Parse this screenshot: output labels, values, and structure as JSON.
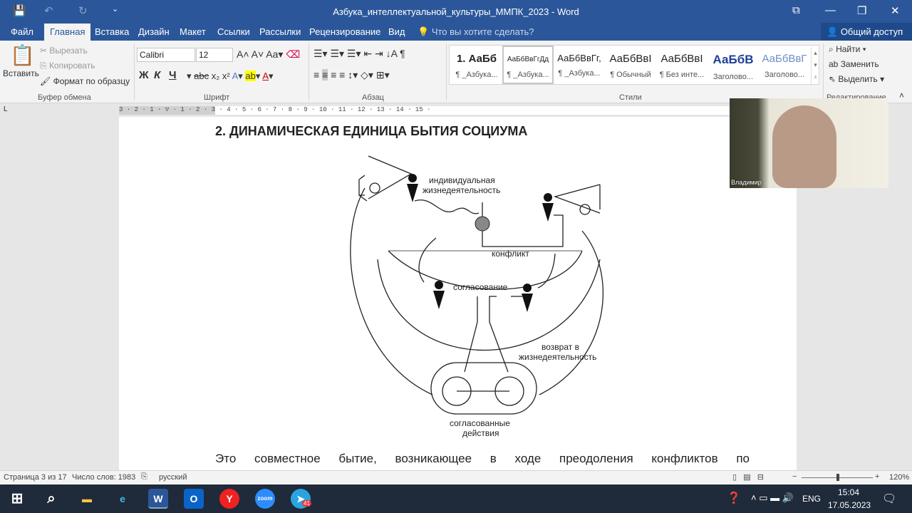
{
  "window": {
    "title": "Азбука_интеллектуальной_культуры_ММПК_2023 - Word"
  },
  "tabs": [
    "Файл",
    "Главная",
    "Вставка",
    "Дизайн",
    "Макет",
    "Ссылки",
    "Рассылки",
    "Рецензирование",
    "Вид"
  ],
  "tell_me": "Что вы хотите сделать?",
  "share": "Общий доступ",
  "clipboard": {
    "paste": "Вставить",
    "cut": "Вырезать",
    "copy": "Копировать",
    "format_painter": "Формат по образцу",
    "group": "Буфер обмена"
  },
  "font": {
    "name": "Calibri",
    "size": "12",
    "group": "Шрифт",
    "bold": "Ж",
    "italic": "К",
    "underline": "Ч"
  },
  "paragraph": {
    "group": "Абзац"
  },
  "styles": {
    "group": "Стили",
    "items": [
      {
        "preview": "1. АаБб",
        "name": "¶ _Азбука..."
      },
      {
        "preview": "АаБбВвГгДд",
        "name": "¶ _Азбука..."
      },
      {
        "preview": "АаБбВвГг,",
        "name": "¶ _Азбука..."
      },
      {
        "preview": "АаБбВвI",
        "name": "¶ Обычный"
      },
      {
        "preview": "АаБбВвI",
        "name": "¶ Без инте..."
      },
      {
        "preview": "АаБбВ",
        "name": "Заголово..."
      },
      {
        "preview": "АаБбВвГ",
        "name": "Заголово..."
      }
    ]
  },
  "editing": {
    "find": "Найти",
    "replace": "Заменить",
    "select": "Выделить",
    "group": "Редактирование"
  },
  "document": {
    "heading": "2. ДИНАМИЧЕСКАЯ ЕДИНИЦА БЫТИЯ СОЦИУМА",
    "diagram_labels": {
      "individual": "индивидуальная",
      "individual2": "жизнедеятельность",
      "conflict": "конфликт",
      "agreement": "согласование",
      "return1": "возврат в",
      "return2": "жизнедеятельность",
      "joint1": "согласованные",
      "joint2": "действия"
    },
    "body_text": "Это совместное бытие, возникающее в ходе преодоления конфликтов по поводу"
  },
  "webcam": {
    "name": "Владимир"
  },
  "status": {
    "page": "Страница 3 из 17",
    "words": "Число слов: 1983",
    "language": "русский",
    "zoom": "120%"
  },
  "taskbar": {
    "lang": "ENG",
    "time": "15:04",
    "date": "17.05.2023",
    "telegram_badge": "41"
  }
}
